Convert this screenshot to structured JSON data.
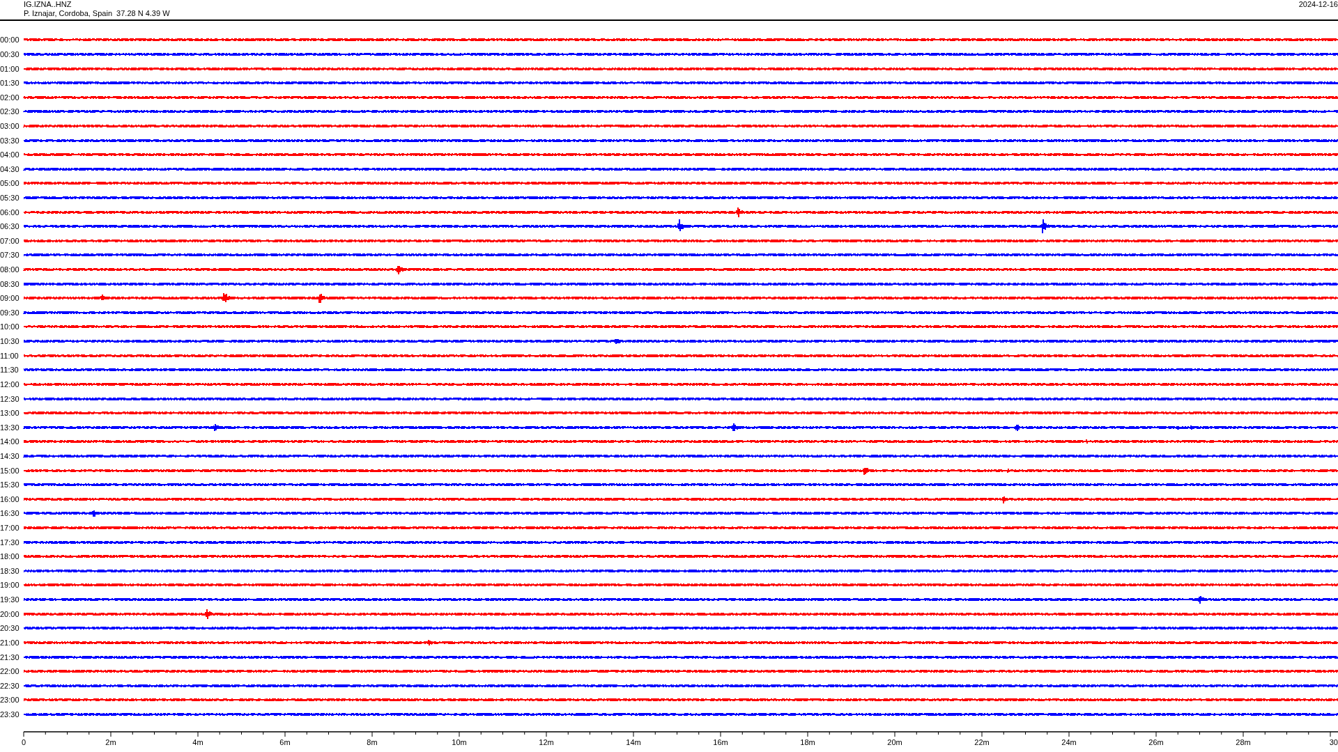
{
  "header": {
    "station": "IG.IZNA..HNZ",
    "location": "P. Iznajar, Cordoba, Spain  37.28 N 4.39 W",
    "date": "2024-12-16"
  },
  "rows": [
    {
      "time": "00:00",
      "color": "#ff0000"
    },
    {
      "time": "00:30",
      "color": "#0000ff"
    },
    {
      "time": "01:00",
      "color": "#ff0000"
    },
    {
      "time": "01:30",
      "color": "#0000ff"
    },
    {
      "time": "02:00",
      "color": "#ff0000"
    },
    {
      "time": "02:30",
      "color": "#0000ff"
    },
    {
      "time": "03:00",
      "color": "#ff0000"
    },
    {
      "time": "03:30",
      "color": "#0000ff"
    },
    {
      "time": "04:00",
      "color": "#ff0000"
    },
    {
      "time": "04:30",
      "color": "#0000ff"
    },
    {
      "time": "05:00",
      "color": "#ff0000"
    },
    {
      "time": "05:30",
      "color": "#0000ff"
    },
    {
      "time": "06:00",
      "color": "#ff0000"
    },
    {
      "time": "06:30",
      "color": "#0000ff"
    },
    {
      "time": "07:00",
      "color": "#ff0000"
    },
    {
      "time": "07:30",
      "color": "#0000ff"
    },
    {
      "time": "08:00",
      "color": "#ff0000"
    },
    {
      "time": "08:30",
      "color": "#0000ff"
    },
    {
      "time": "09:00",
      "color": "#ff0000"
    },
    {
      "time": "09:30",
      "color": "#0000ff"
    },
    {
      "time": "10:00",
      "color": "#ff0000"
    },
    {
      "time": "10:30",
      "color": "#0000ff"
    },
    {
      "time": "11:00",
      "color": "#ff0000"
    },
    {
      "time": "11:30",
      "color": "#0000ff"
    },
    {
      "time": "12:00",
      "color": "#ff0000"
    },
    {
      "time": "12:30",
      "color": "#0000ff"
    },
    {
      "time": "13:00",
      "color": "#ff0000"
    },
    {
      "time": "13:30",
      "color": "#0000ff"
    },
    {
      "time": "14:00",
      "color": "#ff0000"
    },
    {
      "time": "14:30",
      "color": "#0000ff"
    },
    {
      "time": "15:00",
      "color": "#ff0000"
    },
    {
      "time": "15:30",
      "color": "#0000ff"
    },
    {
      "time": "16:00",
      "color": "#ff0000"
    },
    {
      "time": "16:30",
      "color": "#0000ff"
    },
    {
      "time": "17:00",
      "color": "#ff0000"
    },
    {
      "time": "17:30",
      "color": "#0000ff"
    },
    {
      "time": "18:00",
      "color": "#ff0000"
    },
    {
      "time": "18:30",
      "color": "#0000ff"
    },
    {
      "time": "19:00",
      "color": "#ff0000"
    },
    {
      "time": "19:30",
      "color": "#0000ff"
    },
    {
      "time": "20:00",
      "color": "#ff0000"
    },
    {
      "time": "20:30",
      "color": "#0000ff"
    },
    {
      "time": "21:00",
      "color": "#ff0000"
    },
    {
      "time": "21:30",
      "color": "#0000ff"
    },
    {
      "time": "22:00",
      "color": "#ff0000"
    },
    {
      "time": "22:30",
      "color": "#0000ff"
    },
    {
      "time": "23:00",
      "color": "#ff0000"
    },
    {
      "time": "23:30",
      "color": "#0000ff"
    }
  ],
  "x_axis": {
    "labels": [
      "0",
      "2m",
      "4m",
      "6m",
      "8m",
      "10m",
      "12m",
      "14m",
      "16m",
      "18m",
      "20m",
      "22m",
      "24m",
      "26m",
      "28m",
      "30"
    ]
  }
}
